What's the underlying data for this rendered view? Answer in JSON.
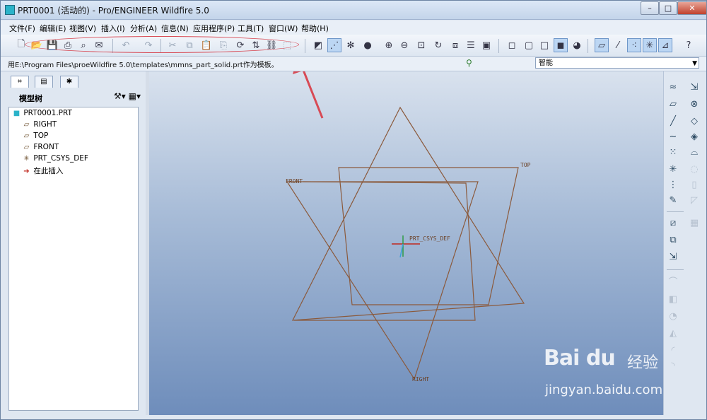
{
  "window": {
    "title": "PRT0001 (活动的) - Pro/ENGINEER Wildfire 5.0",
    "controls": {
      "minimize": "–",
      "maximize": "□",
      "close": "✕"
    }
  },
  "menu": [
    "文件(F)",
    "编辑(E)",
    "视图(V)",
    "插入(I)",
    "分析(A)",
    "信息(N)",
    "应用程序(P)",
    "工具(T)",
    "窗口(W)",
    "帮助(H)"
  ],
  "status": {
    "message": "用E:\\Program Files\\proeWildfire 5.0\\templates\\mmns_part_solid.prt作为模板。",
    "filter_value": "智能"
  },
  "model_tree": {
    "title": "模型树",
    "items": [
      "PRT0001.PRT",
      "RIGHT",
      "TOP",
      "FRONT",
      "PRT_CSYS_DEF",
      "在此插入"
    ]
  },
  "viewport_labels": {
    "front": "FRONT",
    "top": "TOP",
    "right": "RIGHT",
    "csys": "PRT_CSYS_DEF"
  },
  "watermark": {
    "logo": "Bai du",
    "cn": "经验",
    "url": "jingyan.baidu.com"
  },
  "colors": {
    "datum_planes": "#8b5a3c",
    "annotation": "#d84a55",
    "viewport_top": "#d9e2ee",
    "viewport_bottom": "#6e8dbb"
  }
}
